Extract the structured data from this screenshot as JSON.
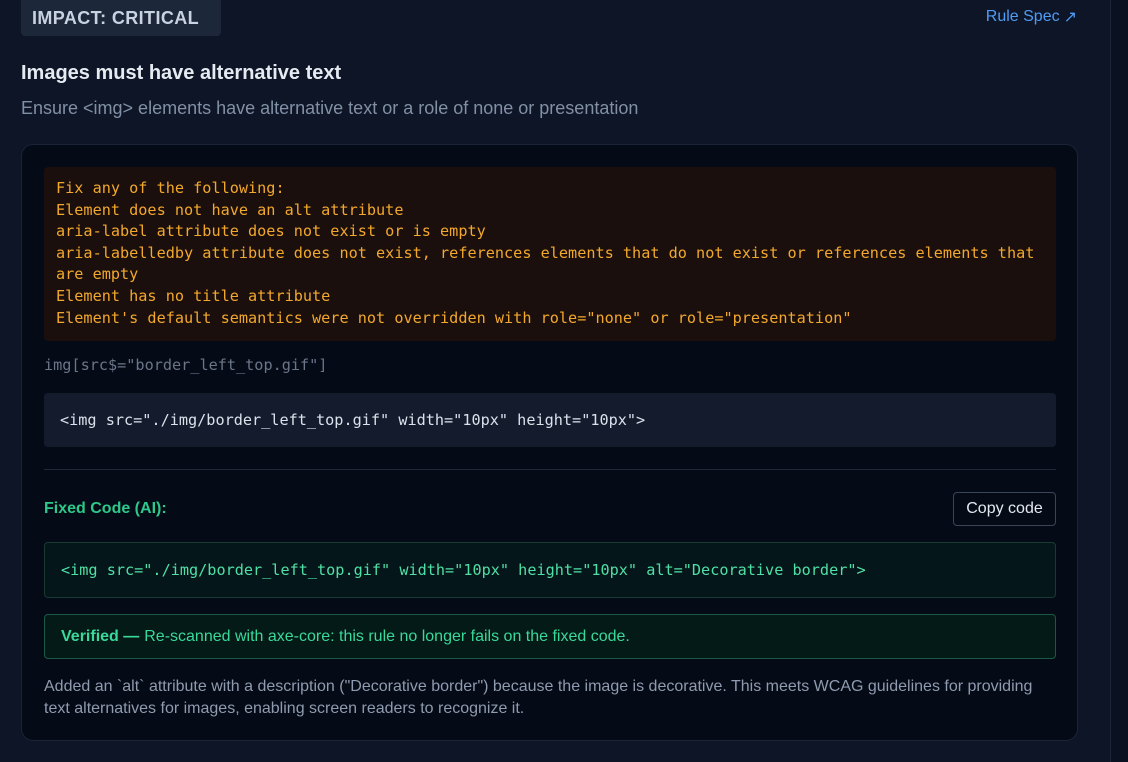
{
  "header": {
    "impact_badge": "IMPACT: CRITICAL",
    "rule_spec_label": "Rule Spec",
    "rule_spec_icon": "external-arrow-icon"
  },
  "rule": {
    "title": "Images must have alternative text",
    "description": "Ensure <img> elements have alternative text or a role of none or presentation"
  },
  "failure": {
    "lines": [
      "Fix any of the following:",
      "Element does not have an alt attribute",
      "aria-label attribute does not exist or is empty",
      "aria-labelledby attribute does not exist, references elements that do not exist or references elements that are empty",
      "Element has no title attribute",
      "Element's default semantics were not overridden with role=\"none\" or role=\"presentation\""
    ]
  },
  "target": {
    "selector": "img[src$=\"border_left_top.gif\"]",
    "original_code": "<img src=\"./img/border_left_top.gif\" width=\"10px\" height=\"10px\">"
  },
  "fix": {
    "label": "Fixed Code (AI):",
    "copy_button": "Copy code",
    "fixed_code": "<img src=\"./img/border_left_top.gif\" width=\"10px\" height=\"10px\" alt=\"Decorative border\">",
    "verified_title": "Verified —",
    "verified_text": "Re-scanned with axe-core: this rule no longer fails on the fixed code.",
    "explanation": "Added an `alt` attribute with a description (\"Decorative border\") because the image is decorative. This meets WCAG guidelines for providing text alternatives for images, enabling screen readers to recognize it."
  }
}
